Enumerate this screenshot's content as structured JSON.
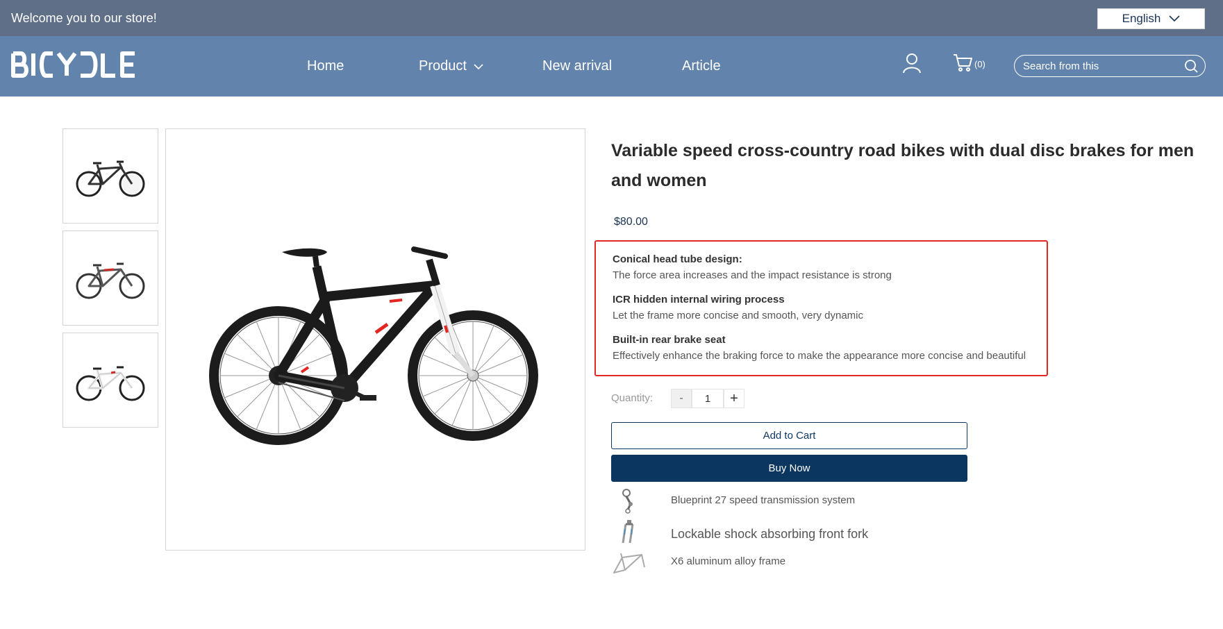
{
  "topbar": {
    "welcome": "Welcome you to our store!",
    "language": "English"
  },
  "header": {
    "logo": "BICYDLE",
    "nav": [
      {
        "label": "Home"
      },
      {
        "label": "Product"
      },
      {
        "label": "New arrival"
      },
      {
        "label": "Article"
      }
    ],
    "cart_count": "(0)",
    "search_placeholder": "Search from this"
  },
  "product": {
    "title": "Variable speed cross-country road bikes with dual disc brakes for men and women",
    "price": "$80.00",
    "features": [
      {
        "title": "Conical head tube design:",
        "desc": "The force area increases and the impact resistance is strong"
      },
      {
        "title": "ICR hidden internal wiring process",
        "desc": "Let the frame more concise and smooth, very dynamic"
      },
      {
        "title": "Built-in rear brake seat",
        "desc": "Effectively enhance the braking force to make the appearance more concise and beautiful"
      }
    ],
    "quantity_label": "Quantity:",
    "quantity_minus": "-",
    "quantity_value": "1",
    "quantity_plus": "+",
    "add_to_cart": "Add to Cart",
    "buy_now": "Buy Now",
    "specs": [
      {
        "icon": "derailleur-icon",
        "text": "Blueprint 27 speed transmission system"
      },
      {
        "icon": "front-fork-icon",
        "text": "Lockable shock absorbing front fork"
      },
      {
        "icon": "bike-frame-icon",
        "text": "X6 aluminum alloy frame"
      }
    ]
  },
  "colors": {
    "topbar": "#5f6f87",
    "navbar": "#6283ab",
    "accent_navy": "#0b365f",
    "highlight_border": "#e3261f"
  }
}
